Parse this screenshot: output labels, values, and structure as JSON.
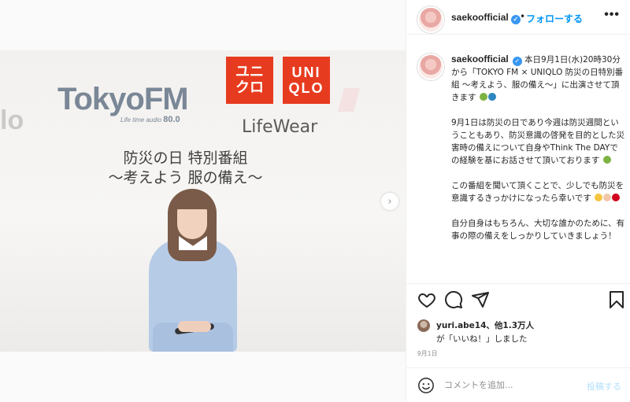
{
  "photo": {
    "sponsor_logo": "TokyoFM",
    "sponsor_logo_fm": "fm",
    "sponsor_tagline": "Life time audio",
    "sponsor_freq": "80.0",
    "brand_kana": "ユニ クロ",
    "brand_latin": "UNI QLO",
    "lifewear": "LifeWear",
    "headline_1": "防災の日 特別番組",
    "headline_2": "〜考えよう 服の備え〜",
    "left_fragment": "lo"
  },
  "header": {
    "username": "saekoofficial",
    "separator": "•",
    "follow_label": "フォローする",
    "more": "•••"
  },
  "caption": {
    "username": "saekoofficial",
    "p1": "本日9月1日(水)20時30分から「TOKYO FM × UNIQLO 防災の日特別番組 〜考えよう、服の備え〜」に出演させて頂きます",
    "p2": "9月1日は防災の日であり今週は防災週間ということもあり、防災意識の啓発を目的とした災害時の備えについて自身やThink The DAYでの経験を基にお話させて頂いております",
    "p3": "この番組を聞いて頂くことで、少しでも防災を意識するきっかけになったら幸いです",
    "p4": "自分自身はもちろん、大切な誰かのために、有事の際の備えをしっかりしていきましょう！"
  },
  "likes": {
    "line1": "yuri.abe14、他1.3万人",
    "line2": "が「いいね！」しました"
  },
  "date": "9月1日",
  "comment": {
    "placeholder": "コメントを追加...",
    "post_label": "投稿する"
  },
  "colors": {
    "link_blue": "#0095f6",
    "uniqlo_red": "#e73b1f",
    "verified_blue": "#3897f0"
  },
  "icons": [
    "heart-icon",
    "comment-icon",
    "share-icon",
    "bookmark-icon",
    "emoji-icon",
    "verified-icon",
    "chevron-right-icon"
  ]
}
